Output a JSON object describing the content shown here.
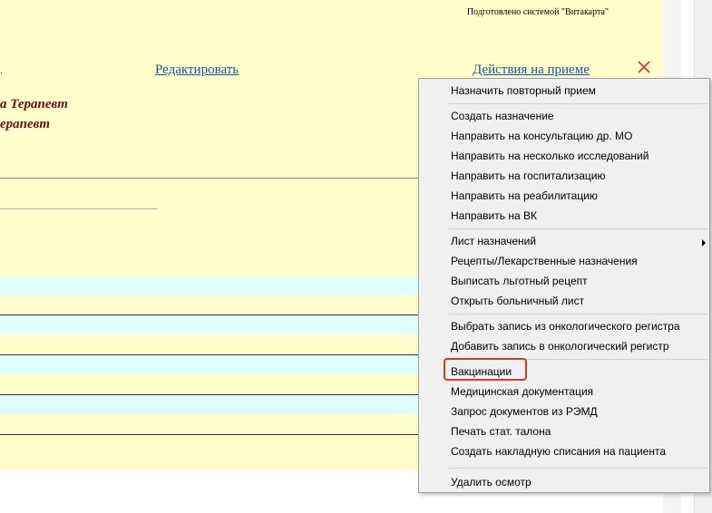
{
  "document": {
    "generated_by": "Подготовлено системой \"Витакарта\"",
    "edit_link": "Редактировать",
    "actions_link": "Действия на приеме",
    "doctor_line1": "а Терапевт",
    "doctor_line2": "ерапевт"
  },
  "icons": {
    "close": "close-icon",
    "submenu": "chevron-right-icon"
  },
  "colors": {
    "doc_bg": "#ffffcc",
    "row_band": "#dfffff",
    "link": "#1f4fa6",
    "doctor_text": "#6b0f0f",
    "close": "#d9372f",
    "highlight": "#d9372f"
  },
  "context_menu": {
    "items": [
      "Назначить повторный прием",
      "Создать назначение",
      "Направить на консультацию др. МО",
      "Направить на несколько исследований",
      "Направить на госпитализацию",
      "Направить на реабилитацию",
      "Направить на ВК",
      "Лист назначений",
      "Рецепты/Лекарственные назначения",
      "Выписать льготный рецепт",
      "Открыть больничный лист",
      "Выбрать запись из онкологического регистра",
      "Добавить запись в онкологический регистр",
      "Вакцинации",
      "Медицинская документация",
      "Запрос документов из РЭМД",
      "Печать стат. талона",
      "Создать накладную списания на пациента",
      "Удалить осмотр"
    ],
    "highlighted_item": "Вакцинации"
  }
}
